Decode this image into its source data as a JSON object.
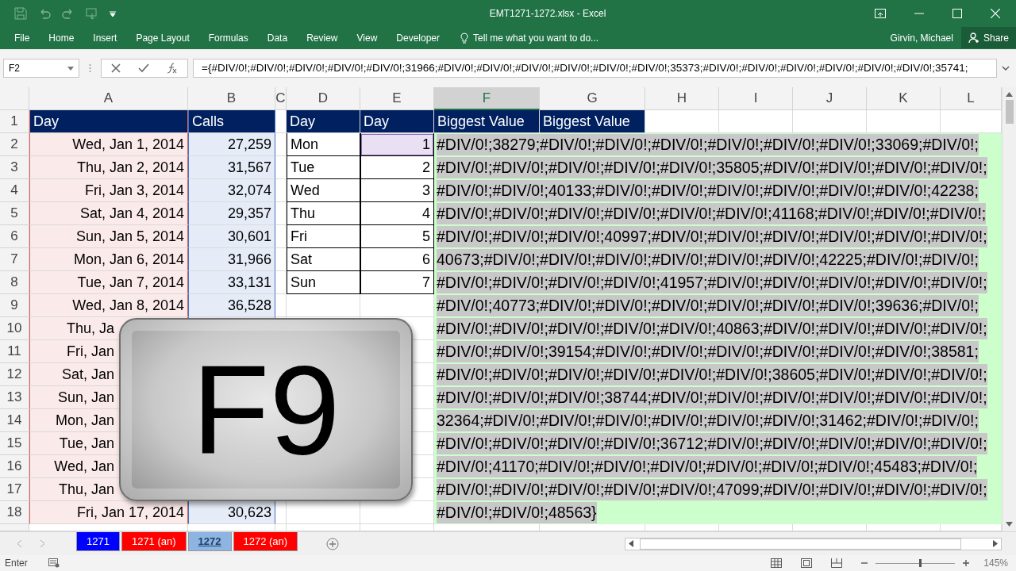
{
  "window": {
    "title": "EMT1271-1272.xlsx - Excel"
  },
  "ribbon": {
    "tabs": [
      {
        "label": "File",
        "selected": false
      },
      {
        "label": "Home",
        "selected": false
      },
      {
        "label": "Insert",
        "selected": false
      },
      {
        "label": "Page Layout",
        "selected": false
      },
      {
        "label": "Formulas",
        "selected": false
      },
      {
        "label": "Data",
        "selected": false
      },
      {
        "label": "Review",
        "selected": false
      },
      {
        "label": "View",
        "selected": false
      },
      {
        "label": "Developer",
        "selected": false
      }
    ],
    "tell_me": "Tell me what you want to do...",
    "user": "Girvin, Michael",
    "share": "Share"
  },
  "formula_bar": {
    "name_box": "F2",
    "formula": "={#DIV/0!;#DIV/0!;#DIV/0!;#DIV/0!;#DIV/0!;31966;#DIV/0!;#DIV/0!;#DIV/0!;#DIV/0!;#DIV/0!;#DIV/0!;35373;#DIV/0!;#DIV/0!;#DIV/0!;#DIV/0!;#DIV/0!;#DIV/0!;35741;"
  },
  "grid": {
    "columns": [
      {
        "letter": "A",
        "selected": false
      },
      {
        "letter": "B",
        "selected": false
      },
      {
        "letter": "C",
        "selected": false
      },
      {
        "letter": "D",
        "selected": false
      },
      {
        "letter": "E",
        "selected": false
      },
      {
        "letter": "F",
        "selected": true
      },
      {
        "letter": "G",
        "selected": false
      },
      {
        "letter": "H",
        "selected": false
      },
      {
        "letter": "I",
        "selected": false
      },
      {
        "letter": "J",
        "selected": false
      },
      {
        "letter": "K",
        "selected": false
      },
      {
        "letter": "L",
        "selected": false
      }
    ],
    "row_numbers": [
      "1",
      "2",
      "3",
      "4",
      "5",
      "6",
      "7",
      "8",
      "9",
      "10",
      "11",
      "12",
      "13",
      "14",
      "15",
      "16",
      "17",
      "18"
    ]
  },
  "calls_table": {
    "headers": [
      {
        "label": "Day",
        "color": "#e06060"
      },
      {
        "label": "Calls",
        "color": "#4472c4"
      }
    ],
    "rows": [
      {
        "day": "Wed, Jan 1, 2014",
        "calls": "27,259"
      },
      {
        "day": "Thu, Jan 2, 2014",
        "calls": "31,567"
      },
      {
        "day": "Fri, Jan 3, 2014",
        "calls": "32,074"
      },
      {
        "day": "Sat, Jan 4, 2014",
        "calls": "29,357"
      },
      {
        "day": "Sun, Jan 5, 2014",
        "calls": "30,601"
      },
      {
        "day": "Mon, Jan 6, 2014",
        "calls": "31,966"
      },
      {
        "day": "Tue, Jan 7, 2014",
        "calls": "33,131"
      },
      {
        "day": "Wed, Jan 8, 2014",
        "calls": "36,528"
      },
      {
        "day": "Thu, Ja"
      },
      {
        "day": "Fri, Jan"
      },
      {
        "day": "Sat, Jan"
      },
      {
        "day": "Sun, Jan"
      },
      {
        "day": "Mon, Jan"
      },
      {
        "day": "Tue, Jan"
      },
      {
        "day": "Wed, Jan"
      },
      {
        "day": "Thu, Jan"
      },
      {
        "day": "Fri, Jan 17, 2014",
        "calls": "30,623"
      }
    ]
  },
  "lookup_table": {
    "headers": [
      "Day",
      "Day"
    ],
    "rows": [
      {
        "name": "Mon",
        "number": "1",
        "referenced": true
      },
      {
        "name": "Tue",
        "number": "2",
        "referenced": false
      },
      {
        "name": "Wed",
        "number": "3",
        "referenced": false
      },
      {
        "name": "Thu",
        "number": "4",
        "referenced": false
      },
      {
        "name": "Fri",
        "number": "5",
        "referenced": false
      },
      {
        "name": "Sat",
        "number": "6",
        "referenced": false
      },
      {
        "name": "Sun",
        "number": "7",
        "referenced": false
      }
    ]
  },
  "result_headers": [
    "Biggest Value",
    "Biggest Value"
  ],
  "cell_editor": {
    "lines": [
      "#DIV/0!;38279;#DIV/0!;#DIV/0!;#DIV/0!;#DIV/0!;#DIV/0!;#DIV/0!;33069;#DIV/0!;",
      "#DIV/0!;#DIV/0!;#DIV/0!;#DIV/0!;#DIV/0!;35805;#DIV/0!;#DIV/0!;#DIV/0!;#DIV/0!;",
      "#DIV/0!;#DIV/0!;40133;#DIV/0!;#DIV/0!;#DIV/0!;#DIV/0!;#DIV/0!;#DIV/0!;42238;",
      "#DIV/0!;#DIV/0!;#DIV/0!;#DIV/0!;#DIV/0!;#DIV/0!;41168;#DIV/0!;#DIV/0!;#DIV/0!;",
      "#DIV/0!;#DIV/0!;#DIV/0!;40997;#DIV/0!;#DIV/0!;#DIV/0!;#DIV/0!;#DIV/0!;#DIV/0!;",
      "40673;#DIV/0!;#DIV/0!;#DIV/0!;#DIV/0!;#DIV/0!;#DIV/0!;42225;#DIV/0!;#DIV/0!;",
      "#DIV/0!;#DIV/0!;#DIV/0!;#DIV/0!;41957;#DIV/0!;#DIV/0!;#DIV/0!;#DIV/0!;#DIV/0!;",
      "#DIV/0!;40773;#DIV/0!;#DIV/0!;#DIV/0!;#DIV/0!;#DIV/0!;#DIV/0!;39636;#DIV/0!;",
      "#DIV/0!;#DIV/0!;#DIV/0!;#DIV/0!;#DIV/0!;40863;#DIV/0!;#DIV/0!;#DIV/0!;#DIV/0!;",
      "#DIV/0!;#DIV/0!;39154;#DIV/0!;#DIV/0!;#DIV/0!;#DIV/0!;#DIV/0!;#DIV/0!;38581;",
      "#DIV/0!;#DIV/0!;#DIV/0!;#DIV/0!;#DIV/0!;#DIV/0!;38605;#DIV/0!;#DIV/0!;#DIV/0!;",
      "#DIV/0!;#DIV/0!;#DIV/0!;38744;#DIV/0!;#DIV/0!;#DIV/0!;#DIV/0!;#DIV/0!;#DIV/0!;",
      "32364;#DIV/0!;#DIV/0!;#DIV/0!;#DIV/0!;#DIV/0!;#DIV/0!;31462;#DIV/0!;#DIV/0!;",
      "#DIV/0!;#DIV/0!;#DIV/0!;#DIV/0!;36712;#DIV/0!;#DIV/0!;#DIV/0!;#DIV/0!;#DIV/0!;",
      "#DIV/0!;41170;#DIV/0!;#DIV/0!;#DIV/0!;#DIV/0!;#DIV/0!;#DIV/0!;45483;#DIV/0!;",
      "#DIV/0!;#DIV/0!;#DIV/0!;#DIV/0!;#DIV/0!;47099;#DIV/0!;#DIV/0!;#DIV/0!;#DIV/0!;",
      "#DIV/0!;#DIV/0!;48563}"
    ]
  },
  "key_overlay": {
    "label": "F9"
  },
  "sheet_tabs": [
    {
      "label": "1271",
      "color": "#0000ff",
      "selected": false
    },
    {
      "label": "1271 (an)",
      "color": "#ff0000",
      "selected": false
    },
    {
      "label": "1272",
      "color": "#8db4e2",
      "selected": true
    },
    {
      "label": "1272 (an)",
      "color": "#ff0000",
      "selected": false
    }
  ],
  "status_bar": {
    "mode": "Enter",
    "zoom": "145%",
    "zoom_slider": {
      "level": 0.55
    }
  }
}
